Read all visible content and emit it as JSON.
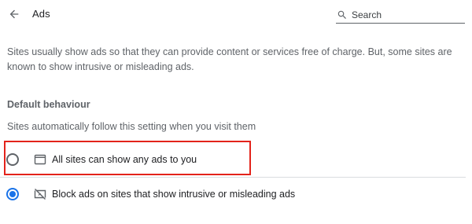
{
  "header": {
    "title": "Ads",
    "back_icon": "arrow-back-icon",
    "search": {
      "placeholder": "Search",
      "value": "",
      "icon": "search-icon"
    }
  },
  "description": "Sites usually show ads so that they can provide content or services free of charge. But, some sites are known to show intrusive or misleading ads.",
  "default_behaviour": {
    "title": "Default behaviour",
    "subtitle": "Sites automatically follow this setting when you visit them",
    "options": [
      {
        "label": "All sites can show any ads to you",
        "icon": "window-icon",
        "selected": false
      },
      {
        "label": "Block ads on sites that show intrusive or misleading ads",
        "icon": "ads-blocked-icon",
        "selected": true
      }
    ]
  },
  "colors": {
    "accent": "#1a73e8",
    "highlight": "#e3231b",
    "text_primary": "#202124",
    "text_secondary": "#5f6368"
  }
}
